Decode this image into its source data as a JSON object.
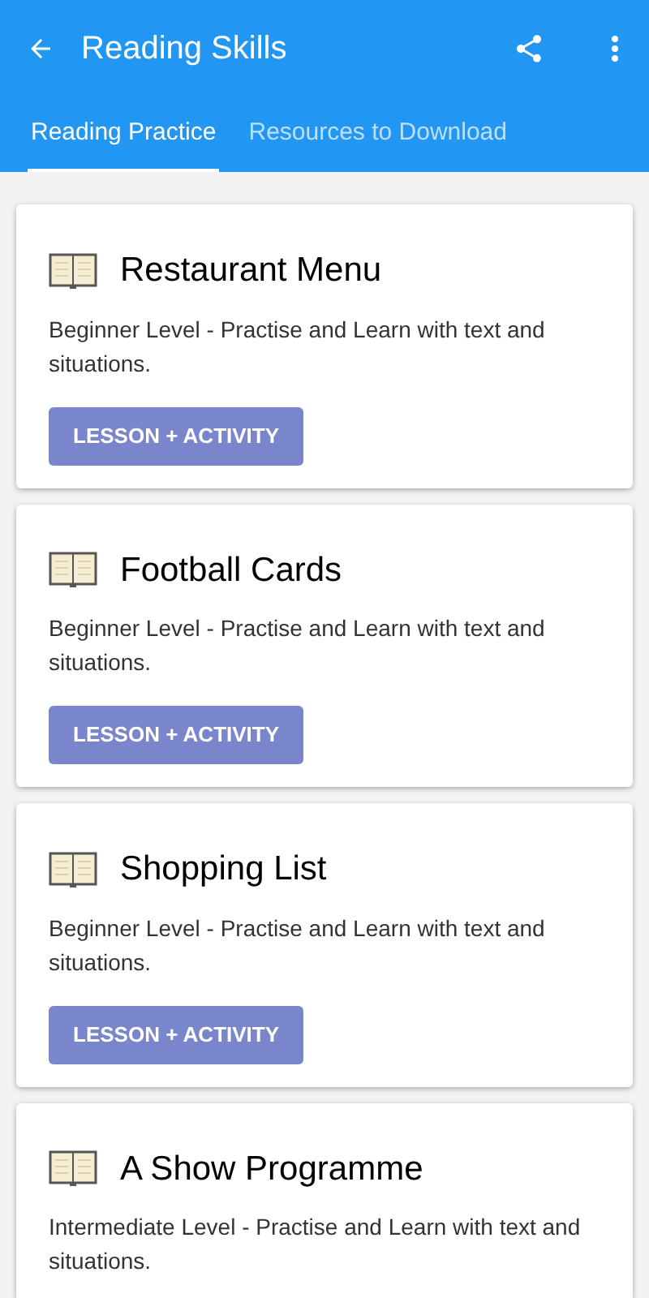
{
  "app_bar": {
    "title": "Reading Skills"
  },
  "tabs": [
    {
      "label": "Reading Practice",
      "selected": true
    },
    {
      "label": "Resources to Download",
      "selected": false
    }
  ],
  "cards": [
    {
      "title": "Restaurant Menu",
      "description": "Beginner Level - Practise and Learn with text and situations.",
      "button": "LESSON + ACTIVITY"
    },
    {
      "title": "Football Cards",
      "description": "Beginner Level - Practise and Learn with text and situations.",
      "button": "LESSON + ACTIVITY"
    },
    {
      "title": "Shopping List",
      "description": "Beginner Level - Practise and Learn with text and situations.",
      "button": "LESSON + ACTIVITY"
    },
    {
      "title": "A Show Programme",
      "description": "Intermediate Level - Practise and Learn with text and situations."
    }
  ]
}
